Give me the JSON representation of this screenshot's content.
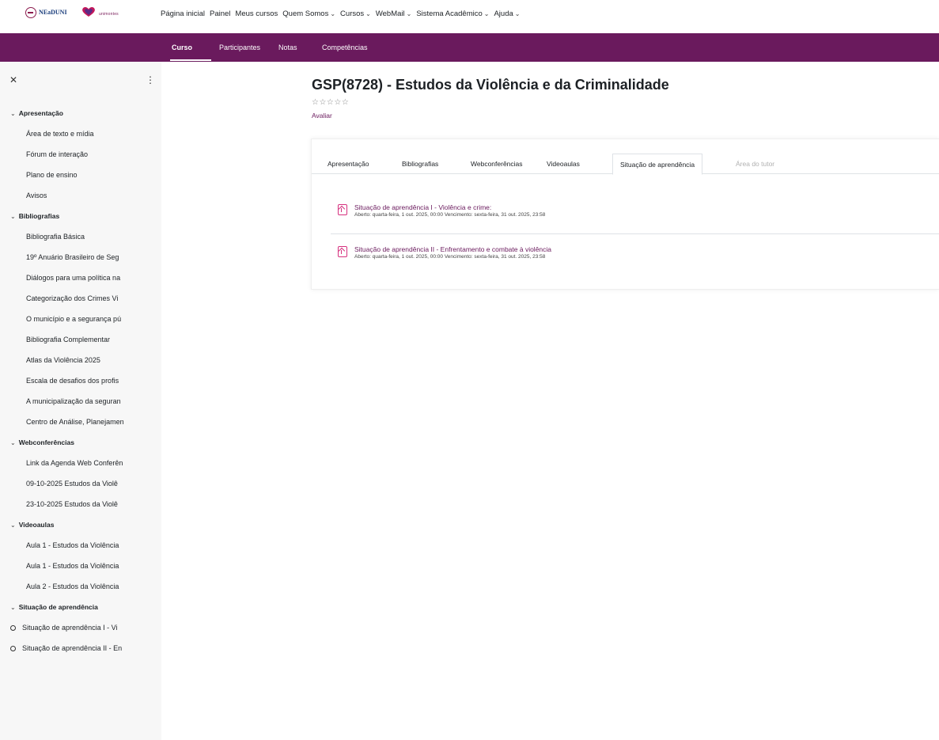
{
  "topnav": {
    "logo1_text": "NEaDUNI",
    "logo2_text": "unimontes",
    "items": [
      {
        "label": "Página inicial",
        "dropdown": false
      },
      {
        "label": "Painel",
        "dropdown": false
      },
      {
        "label": "Meus cursos",
        "dropdown": false
      },
      {
        "label": "Quem Somos",
        "dropdown": true
      },
      {
        "label": "Cursos",
        "dropdown": true
      },
      {
        "label": "WebMail",
        "dropdown": true
      },
      {
        "label": "Sistema Acadêmico",
        "dropdown": true
      },
      {
        "label": "Ajuda",
        "dropdown": true
      }
    ]
  },
  "secondary_nav": {
    "tabs": [
      {
        "label": "Curso",
        "active": true
      },
      {
        "label": "Participantes",
        "active": false
      },
      {
        "label": "Notas",
        "active": false
      },
      {
        "label": "Competências",
        "active": false
      }
    ]
  },
  "drawer": {
    "close_icon": "close-icon",
    "menu_icon": "kebab-icon",
    "items": [
      {
        "type": "section",
        "label": "Apresentação"
      },
      {
        "type": "leaf",
        "label": "Área de texto e mídia"
      },
      {
        "type": "leaf",
        "label": "Fórum de interação"
      },
      {
        "type": "leaf",
        "label": "Plano de ensino"
      },
      {
        "type": "leaf",
        "label": "Avisos"
      },
      {
        "type": "section",
        "label": "Bibliografias"
      },
      {
        "type": "leaf",
        "label": "Bibliografia Básica"
      },
      {
        "type": "leaf",
        "label": "19º Anuário Brasileiro de Seg"
      },
      {
        "type": "leaf",
        "label": "Diálogos para uma política na"
      },
      {
        "type": "leaf",
        "label": "Categorização dos Crimes Vi"
      },
      {
        "type": "leaf",
        "label": "O município e a segurança pú"
      },
      {
        "type": "leaf",
        "label": "Bibliografia Complementar"
      },
      {
        "type": "leaf",
        "label": "Atlas da Violência 2025"
      },
      {
        "type": "leaf",
        "label": "Escala de desafios dos profis"
      },
      {
        "type": "leaf",
        "label": "A municipalização da seguran"
      },
      {
        "type": "leaf",
        "label": "Centro de Análise, Planejamen"
      },
      {
        "type": "section",
        "label": "Webconferências"
      },
      {
        "type": "leaf",
        "label": "Link da Agenda Web Conferên"
      },
      {
        "type": "leaf",
        "label": "09-10-2025 Estudos da Violê"
      },
      {
        "type": "leaf",
        "label": "23-10-2025 Estudos da Violê"
      },
      {
        "type": "section",
        "label": "Videoaulas"
      },
      {
        "type": "leaf",
        "label": "Aula 1 - Estudos da Violência"
      },
      {
        "type": "leaf",
        "label": "Aula 1 - Estudos da Violência"
      },
      {
        "type": "leaf",
        "label": "Aula 2 - Estudos da Violência"
      },
      {
        "type": "section",
        "label": "Situação de aprendência"
      },
      {
        "type": "leafdot",
        "label": "Situação de aprendência I - Vi"
      },
      {
        "type": "leafdot",
        "label": "Situação de aprendência II - En"
      }
    ]
  },
  "course": {
    "title": "GSP(8728) - Estudos da Violência e da Criminalidade",
    "stars": "☆☆☆☆☆",
    "rate_link": "Avaliar"
  },
  "section_tabs": [
    {
      "label": "Apresentação",
      "active": false,
      "muted": false
    },
    {
      "label": "Bibliografias",
      "active": false,
      "muted": false
    },
    {
      "label": "Webconferências",
      "active": false,
      "muted": false
    },
    {
      "label": "Videoaulas",
      "active": false,
      "muted": false
    },
    {
      "label": "Situação de aprendência",
      "active": true,
      "muted": false
    },
    {
      "label": "Área do tutor",
      "active": false,
      "muted": true
    }
  ],
  "activities": [
    {
      "icon": "assignment-icon",
      "name": "Situação de aprendência I - Violência e crime:",
      "dates": "Aberto: quarta-feira, 1 out. 2025, 00:00   Vencimento: sexta-feira, 31 out. 2025, 23:58"
    },
    {
      "icon": "assignment-icon",
      "name": "Situação de aprendência II - Enfrentamento e combate à violência",
      "dates": "Aberto: quarta-feira, 1 out. 2025, 00:00   Vencimento: sexta-feira, 31 out. 2025, 23:58"
    }
  ]
}
